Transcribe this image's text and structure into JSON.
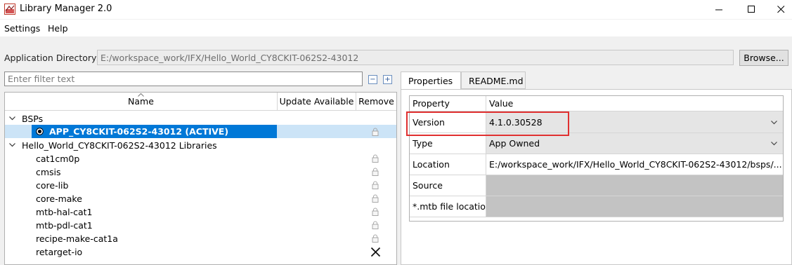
{
  "window": {
    "title": "Library Manager 2.0",
    "icon": "library-manager-app-icon",
    "controls": [
      "minimize-icon",
      "maximize-icon",
      "close-icon"
    ]
  },
  "menubar": {
    "settings": "Settings",
    "help": "Help"
  },
  "app_directory": {
    "label": "Application Directory:",
    "value": "E:/workspace_work/IFX/Hello_World_CY8CKIT-062S2-43012",
    "browse_label": "Browse..."
  },
  "filter": {
    "placeholder": "Enter filter text",
    "collapse_icon": "collapse-all-icon",
    "expand_icon": "expand-all-icon"
  },
  "tree": {
    "columns": {
      "name": "Name",
      "update": "Update Available",
      "remove": "Remove"
    },
    "bsps_label": "BSPs",
    "bsp_item": "APP_CY8CKIT-062S2-43012 (ACTIVE)",
    "libraries_label": "Hello_World_CY8CKIT-062S2-43012 Libraries",
    "libraries": [
      {
        "name": "cat1cm0p",
        "remove_icon": "lock-icon"
      },
      {
        "name": "cmsis",
        "remove_icon": "lock-icon"
      },
      {
        "name": "core-lib",
        "remove_icon": "lock-icon"
      },
      {
        "name": "core-make",
        "remove_icon": "lock-icon"
      },
      {
        "name": "mtb-hal-cat1",
        "remove_icon": "lock-icon"
      },
      {
        "name": "mtb-pdl-cat1",
        "remove_icon": "lock-icon"
      },
      {
        "name": "recipe-make-cat1a",
        "remove_icon": "lock-icon"
      },
      {
        "name": "retarget-io",
        "remove_icon": "remove-x-icon"
      }
    ]
  },
  "tabs": [
    "Properties",
    "README.md"
  ],
  "properties": {
    "header_property": "Property",
    "header_value": "Value",
    "rows": [
      {
        "property": "Version",
        "value": "4.1.0.30528",
        "kind": "dropdown"
      },
      {
        "property": "Type",
        "value": "App Owned",
        "kind": "dropdown"
      },
      {
        "property": "Location",
        "value": "E:/workspace_work/IFX/Hello_World_CY8CKIT-062S2-43012/bsps/...",
        "kind": "text"
      },
      {
        "property": "Source",
        "value": "",
        "kind": "disabled"
      },
      {
        "property": "*.mtb file location",
        "value": "",
        "kind": "disabled"
      }
    ]
  },
  "colors": {
    "selection": "#0078d7",
    "highlight": "#e03030",
    "disabled_cell": "#c3c3c3"
  }
}
